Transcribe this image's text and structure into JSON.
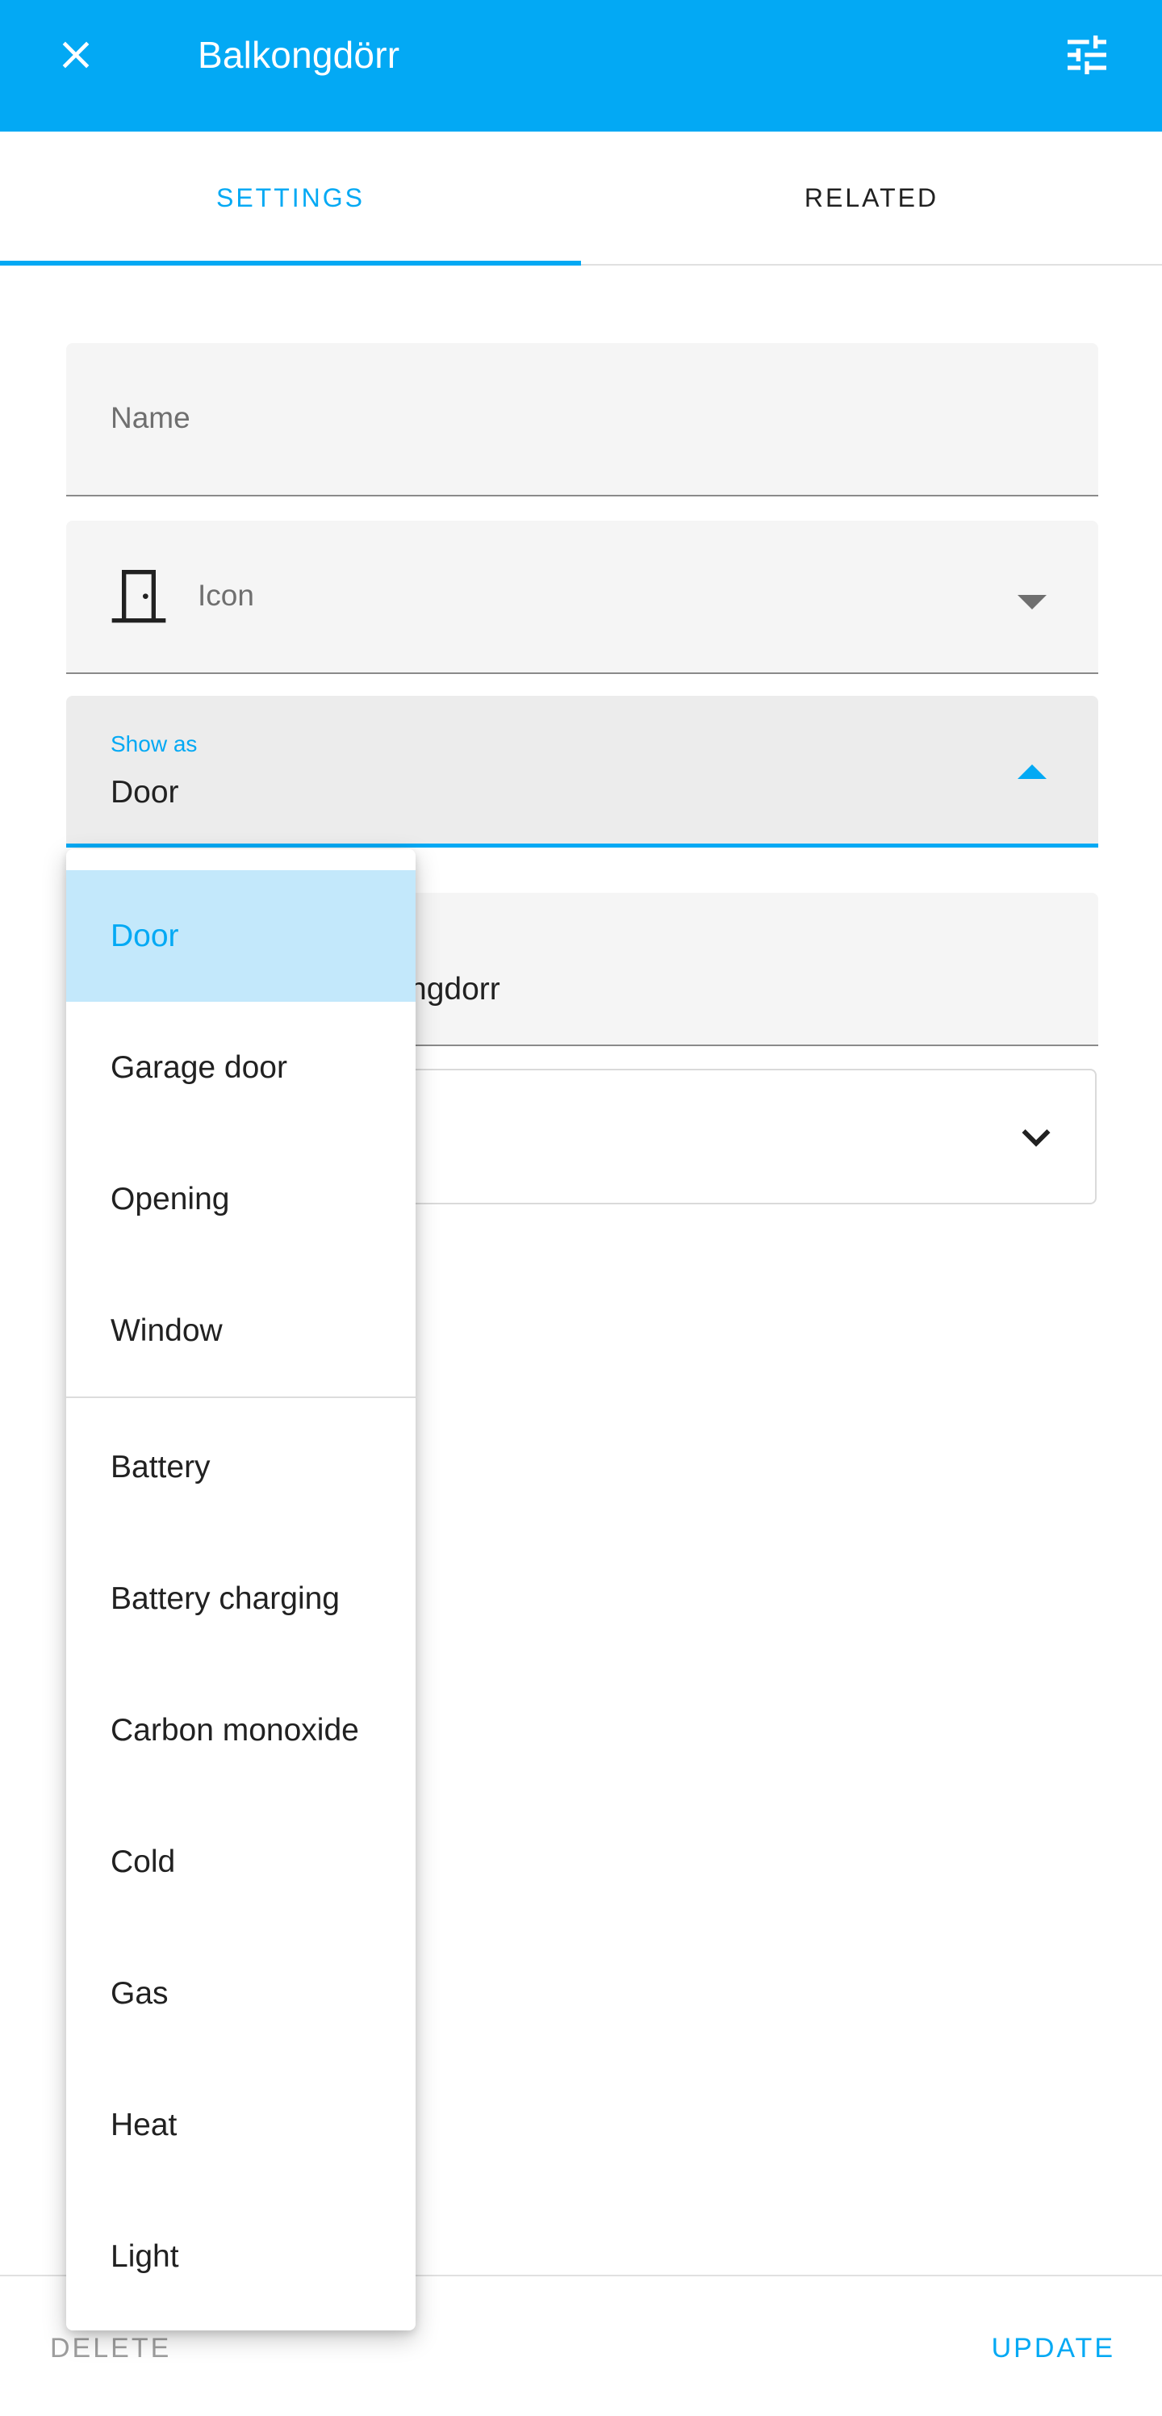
{
  "header": {
    "title": "Balkongdörr",
    "close_icon": "close-icon",
    "tune_icon": "tune-icon"
  },
  "tabs": [
    {
      "label": "SETTINGS",
      "active": true
    },
    {
      "label": "RELATED",
      "active": false
    }
  ],
  "form": {
    "name_placeholder": "Name",
    "icon_placeholder": "Icon",
    "icon_name": "door-icon",
    "show_as": {
      "label": "Show as",
      "value": "Door"
    },
    "entity_id_partial": "ngdorr"
  },
  "menu": {
    "items": [
      {
        "label": "Door",
        "selected": true
      },
      {
        "label": "Garage door"
      },
      {
        "label": "Opening"
      },
      {
        "label": "Window"
      }
    ],
    "items_more": [
      {
        "label": "Battery"
      },
      {
        "label": "Battery charging"
      },
      {
        "label": "Carbon monoxide"
      },
      {
        "label": "Cold"
      },
      {
        "label": "Gas"
      },
      {
        "label": "Heat"
      },
      {
        "label": "Light"
      }
    ]
  },
  "footer": {
    "delete_label": "DELETE",
    "update_label": "UPDATE"
  },
  "colors": {
    "primary": "#03a9f4",
    "selected_bg": "#c3e8fb"
  }
}
